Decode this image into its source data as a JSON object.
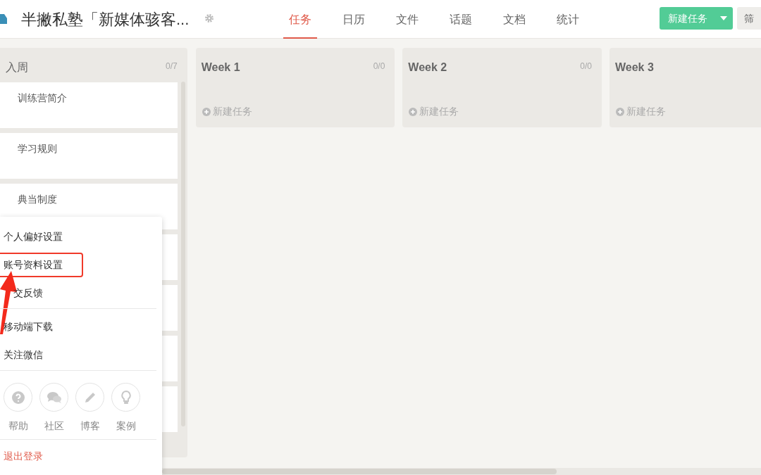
{
  "header": {
    "title": "半撇私塾「新媒体骇客...",
    "tabs": [
      {
        "label": "任务",
        "selected": true
      },
      {
        "label": "日历",
        "selected": false
      },
      {
        "label": "文件",
        "selected": false
      },
      {
        "label": "话题",
        "selected": false
      },
      {
        "label": "文档",
        "selected": false
      },
      {
        "label": "统计",
        "selected": false
      }
    ],
    "new_task_button": "新建任务",
    "filter_button": "筛"
  },
  "columns": [
    {
      "title": "入周",
      "count": "0/7",
      "cards": [
        {
          "title": "训练营简介"
        },
        {
          "title": "学习规则"
        },
        {
          "title": "典当制度"
        }
      ]
    },
    {
      "title": "Week 1",
      "count": "0/0",
      "add_task": "新建任务"
    },
    {
      "title": "Week 2",
      "count": "0/0",
      "add_task": "新建任务"
    },
    {
      "title": "Week 3",
      "add_task": "新建任务"
    }
  ],
  "user_menu": {
    "sections": [
      [
        {
          "label": "个人偏好设置",
          "highlighted": false
        },
        {
          "label": "账号资料设置",
          "highlighted": true
        },
        {
          "label": "交反馈",
          "highlighted": false
        }
      ],
      [
        {
          "label": "移动端下载",
          "highlighted": false
        },
        {
          "label": "关注微信",
          "highlighted": false
        }
      ]
    ],
    "icon_links": [
      {
        "label": "帮助",
        "kind": "help"
      },
      {
        "label": "社区",
        "kind": "chat"
      },
      {
        "label": "博客",
        "kind": "pencil"
      },
      {
        "label": "案例",
        "kind": "bulb"
      }
    ],
    "logout": "退出登录"
  }
}
